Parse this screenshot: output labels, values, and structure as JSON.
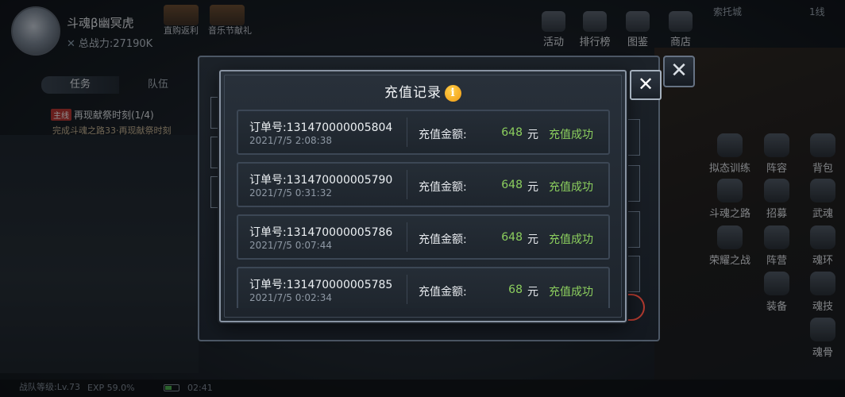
{
  "player": {
    "name": "斗魂β幽冥虎",
    "power": "总战力:27190K"
  },
  "top_events": [
    {
      "label": "直购返利"
    },
    {
      "label": "音乐节献礼"
    }
  ],
  "top_buttons": [
    {
      "label": "活动",
      "icon": "activity-icon"
    },
    {
      "label": "排行榜",
      "icon": "trophy-icon"
    },
    {
      "label": "图鉴",
      "icon": "codex-icon"
    },
    {
      "label": "商店",
      "icon": "shop-icon"
    }
  ],
  "location": "索托城",
  "line": "1线",
  "task_panel": {
    "tabs": [
      "任务",
      "队伍"
    ],
    "quest_tag": "主线",
    "quest_title": "再现献祭时刻(1/4)",
    "quest_desc": "完成斗魂之路33·再现献祭时刻"
  },
  "side_buttons": [
    {
      "label": "拟态训练"
    },
    {
      "label": "阵容"
    },
    {
      "label": "背包"
    },
    {
      "label": "斗魂之路"
    },
    {
      "label": "招募"
    },
    {
      "label": "武魂"
    },
    {
      "label": "荣耀之战"
    },
    {
      "label": "阵营"
    },
    {
      "label": "魂环"
    },
    {
      "label": "装备"
    },
    {
      "label": "魂技"
    },
    {
      "label": "魂骨"
    }
  ],
  "status_bar": {
    "team_level": "战队等级:Lv.73",
    "exp": "EXP 59.0%",
    "time": "02:41"
  },
  "dialog": {
    "title": "充值记录",
    "info_icon": "i",
    "close_icon": "✕",
    "amount_label": "充值金额:",
    "unit": "元",
    "records": [
      {
        "order": "订单号:131470000005804",
        "date": "2021/7/5 2:08:38",
        "amount": "648",
        "status": "充值成功"
      },
      {
        "order": "订单号:131470000005790",
        "date": "2021/7/5 0:31:32",
        "amount": "648",
        "status": "充值成功"
      },
      {
        "order": "订单号:131470000005786",
        "date": "2021/7/5 0:07:44",
        "amount": "648",
        "status": "充值成功"
      },
      {
        "order": "订单号:131470000005785",
        "date": "2021/7/5 0:02:34",
        "amount": "68",
        "status": "充值成功"
      }
    ]
  },
  "colors": {
    "success_green": "#8ccf5e",
    "info_orange": "#f09a12",
    "dialog_border": "#8893a2"
  }
}
